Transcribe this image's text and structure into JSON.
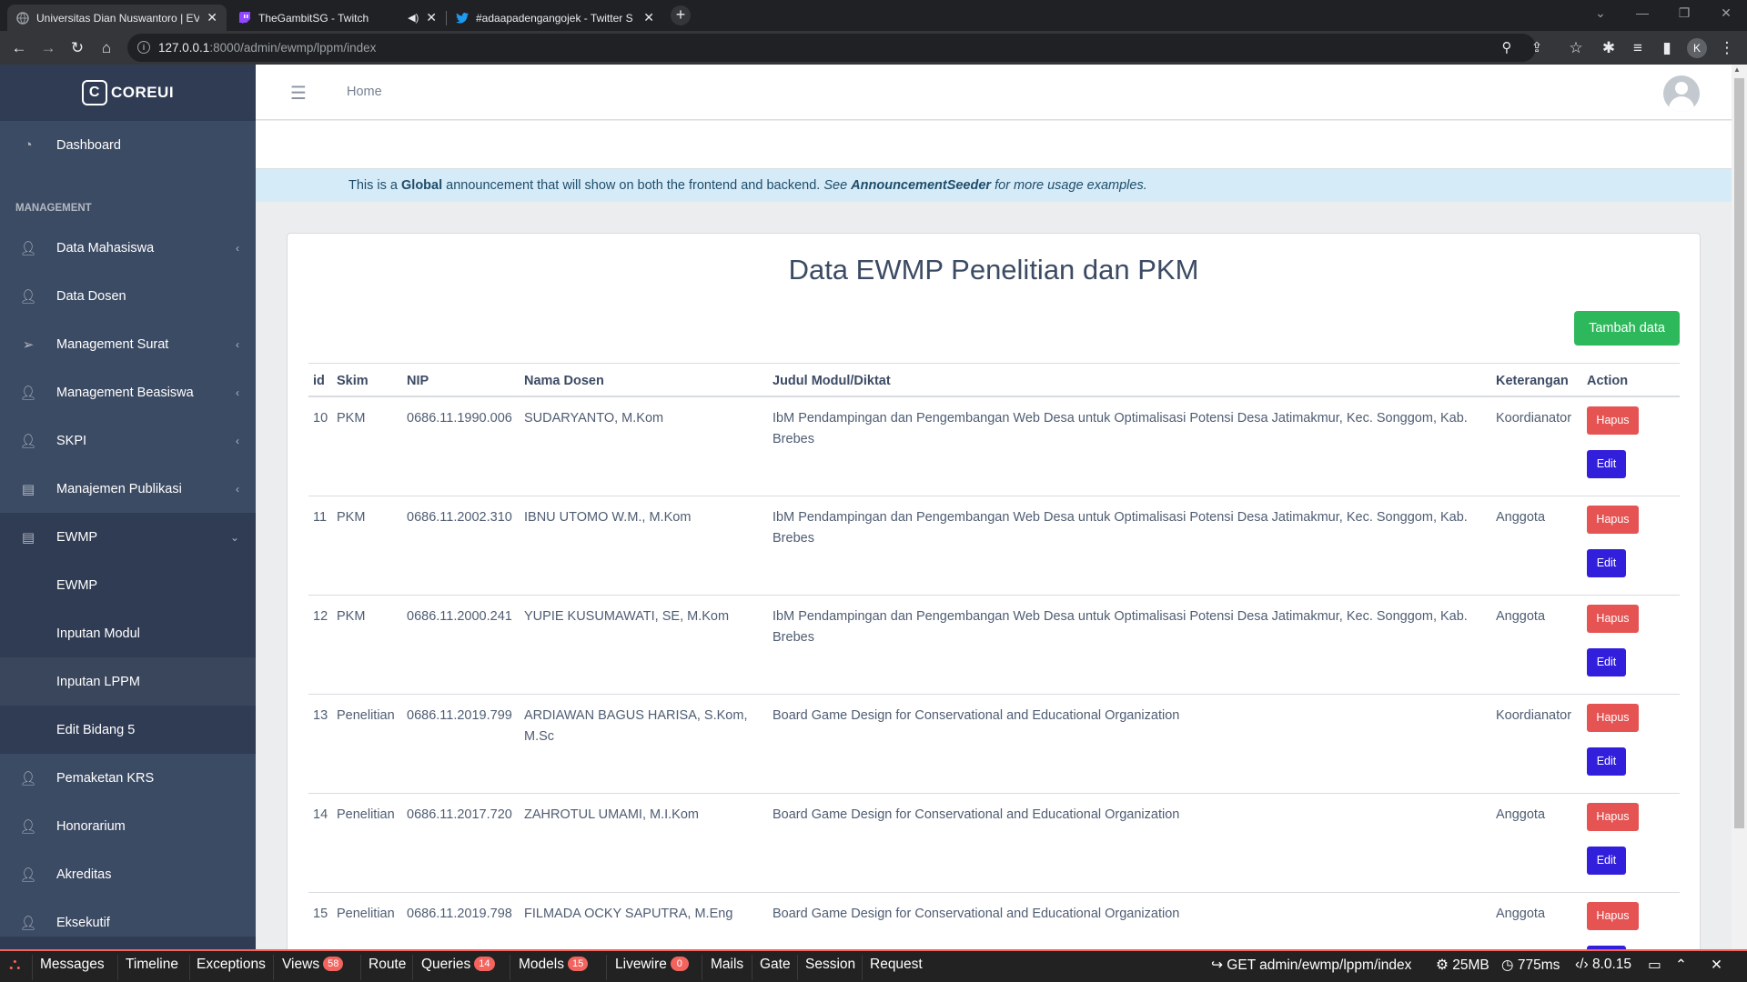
{
  "browser": {
    "tabs": [
      {
        "title": "Universitas Dian Nuswantoro | EV",
        "icon": "globe-icon"
      },
      {
        "title": "TheGambitSG - Twitch",
        "icon": "twitch-icon"
      },
      {
        "title": "#adaapadengangojek - Twitter S",
        "icon": "twitter-icon"
      }
    ],
    "url_host": "127.0.0.1",
    "url_path": ":8000/admin/ewmp/lppm/index",
    "profile_initial": "K"
  },
  "brand": {
    "name": "COREUI"
  },
  "sidebar": {
    "dashboard": "Dashboard",
    "section_title": "MANAGEMENT",
    "items": [
      {
        "label": "Data Mahasiswa",
        "icon": "user-icon",
        "chevron": true
      },
      {
        "label": "Data Dosen",
        "icon": "user-icon",
        "chevron": false
      },
      {
        "label": "Management Surat",
        "icon": "paper-plane-icon",
        "chevron": true
      },
      {
        "label": "Management Beasiswa",
        "icon": "user-icon",
        "chevron": true
      },
      {
        "label": "SKPI",
        "icon": "user-icon",
        "chevron": true
      },
      {
        "label": "Manajemen Publikasi",
        "icon": "newspaper-icon",
        "chevron": true
      }
    ],
    "ewmp": {
      "label": "EWMP",
      "children": [
        "EWMP",
        "Inputan Modul",
        "Inputan LPPM",
        "Edit Bidang 5"
      ],
      "active_child": "Inputan LPPM"
    },
    "bottom_items": [
      "Pemaketan KRS",
      "Honorarium",
      "Akreditas",
      "Eksekutif"
    ]
  },
  "header": {
    "home": "Home"
  },
  "announcement": {
    "pre": "This is a ",
    "global": "Global",
    "mid": " announcement that will show on both the frontend and backend. ",
    "see": "See ",
    "seeder": "AnnouncementSeeder",
    "post": " for more usage examples."
  },
  "page": {
    "title": "Data EWMP Penelitian dan PKM",
    "add_button": "Tambah data"
  },
  "table": {
    "headers": [
      "id",
      "Skim",
      "NIP",
      "Nama Dosen",
      "Judul Modul/Diktat",
      "Keterangan",
      "Action"
    ],
    "delete_label": "Hapus",
    "edit_label": "Edit",
    "rows": [
      {
        "id": "10",
        "skim": "PKM",
        "nip": "0686.11.1990.006",
        "nama": "SUDARYANTO, M.Kom",
        "judul": "IbM Pendampingan dan Pengembangan Web Desa untuk Optimalisasi Potensi Desa Jatimakmur, Kec. Songgom, Kab. Brebes",
        "ket": "Koordianator"
      },
      {
        "id": "11",
        "skim": "PKM",
        "nip": "0686.11.2002.310",
        "nama": "IBNU UTOMO W.M., M.Kom",
        "judul": "IbM Pendampingan dan Pengembangan Web Desa untuk Optimalisasi Potensi Desa Jatimakmur, Kec. Songgom, Kab. Brebes",
        "ket": "Anggota"
      },
      {
        "id": "12",
        "skim": "PKM",
        "nip": "0686.11.2000.241",
        "nama": "YUPIE KUSUMAWATI, SE, M.Kom",
        "judul": "IbM Pendampingan dan Pengembangan Web Desa untuk Optimalisasi Potensi Desa Jatimakmur, Kec. Songgom, Kab. Brebes",
        "ket": "Anggota"
      },
      {
        "id": "13",
        "skim": "Penelitian",
        "nip": "0686.11.2019.799",
        "nama": "ARDIAWAN BAGUS HARISA, S.Kom, M.Sc",
        "judul": "Board Game Design for Conservational and Educational Organization",
        "ket": "Koordianator"
      },
      {
        "id": "14",
        "skim": "Penelitian",
        "nip": "0686.11.2017.720",
        "nama": "ZAHROTUL UMAMI, M.I.Kom",
        "judul": "Board Game Design for Conservational and Educational Organization",
        "ket": "Anggota"
      },
      {
        "id": "15",
        "skim": "Penelitian",
        "nip": "0686.11.2019.798",
        "nama": "FILMADA OCKY SAPUTRA, M.Eng",
        "judul": "Board Game Design for Conservational and Educational Organization",
        "ket": "Anggota"
      }
    ]
  },
  "debugbar": {
    "messages": "Messages",
    "timeline": "Timeline",
    "exceptions": "Exceptions",
    "views": "Views",
    "views_count": "58",
    "route": "Route",
    "queries": "Queries",
    "queries_count": "14",
    "models": "Models",
    "models_count": "15",
    "livewire": "Livewire",
    "livewire_count": "0",
    "mails": "Mails",
    "gate": "Gate",
    "session": "Session",
    "request": "Request",
    "method_route": "GET admin/ewmp/lppm/index",
    "memory": "25MB",
    "time": "775ms",
    "version": "8.0.15"
  }
}
